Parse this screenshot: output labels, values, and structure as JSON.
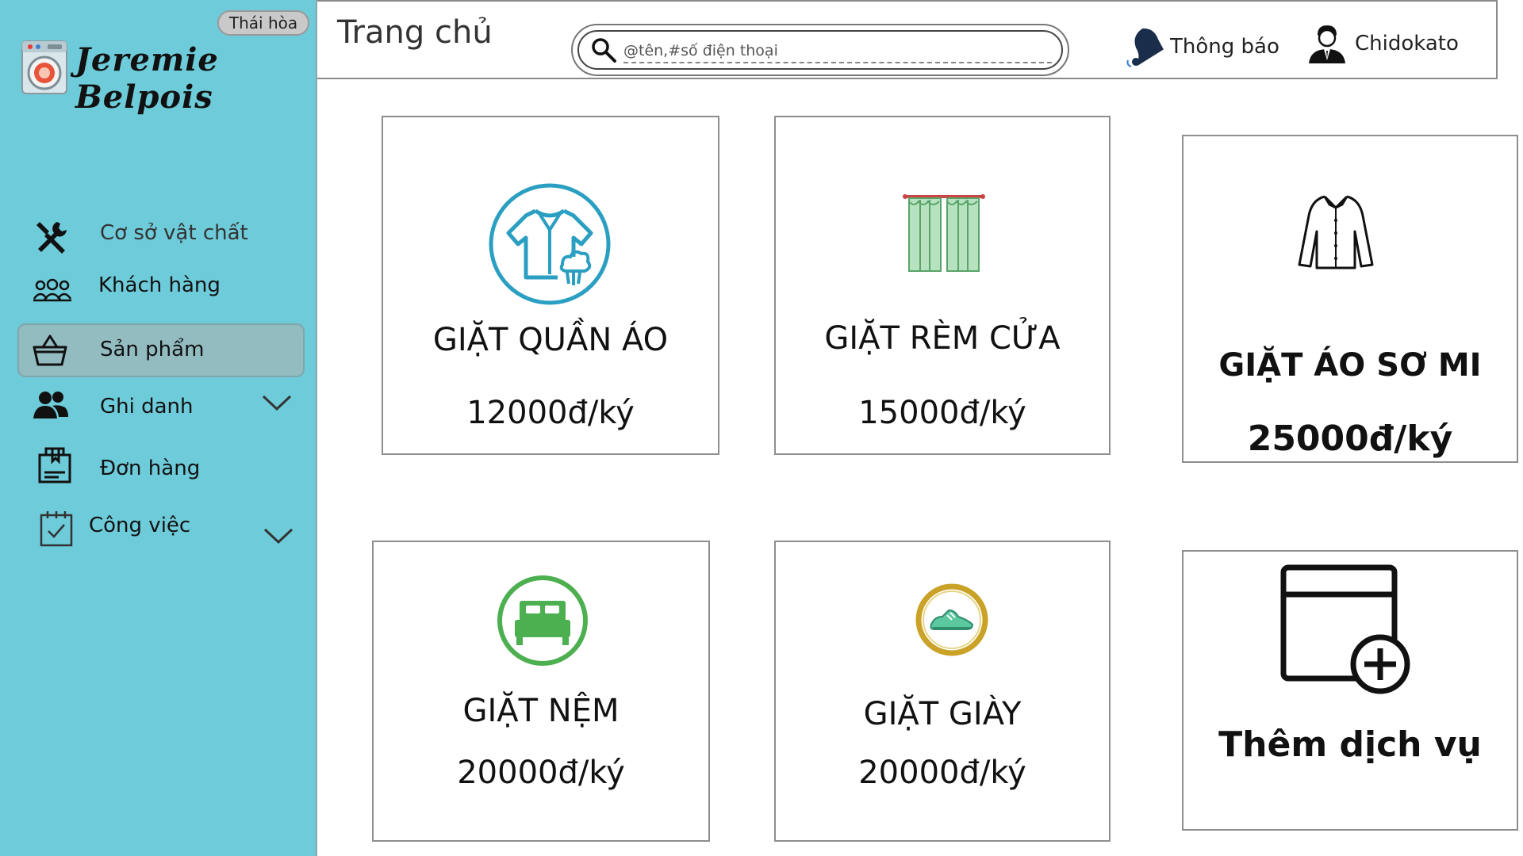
{
  "sidebar": {
    "branch_badge": "Thái hòa",
    "brand_name": "Jeremie Belpois",
    "logo_icon": "washing-machine-icon",
    "items": [
      {
        "label": "Cơ sở vật chất",
        "icon": "tools-icon",
        "active": false,
        "expandable": false
      },
      {
        "label": "Khách hàng",
        "icon": "customers-icon",
        "active": false,
        "expandable": false
      },
      {
        "label": "Sản phẩm",
        "icon": "basket-icon",
        "active": true,
        "expandable": false
      },
      {
        "label": "Ghi danh",
        "icon": "users-icon",
        "active": false,
        "expandable": true
      },
      {
        "label": "Đơn hàng",
        "icon": "package-icon",
        "active": false,
        "expandable": false
      },
      {
        "label": "Công việc",
        "icon": "calendar-check-icon",
        "active": false,
        "expandable": true
      }
    ]
  },
  "header": {
    "title": "Trang chủ",
    "search": {
      "placeholder": "@tên,#số điện thoại",
      "value": ""
    },
    "notifications_label": "Thông báo",
    "user_name": "Chidokato"
  },
  "services": [
    {
      "title": "GIẶT QUẦN ÁO",
      "price": "12000đ/ký",
      "icon": "shirt-wash-icon"
    },
    {
      "title": "GIẶT RÈM CỬA",
      "price": "15000đ/ký",
      "icon": "curtain-icon"
    },
    {
      "title": "GIẶT ÁO SƠ MI",
      "price": "25000đ/ký",
      "icon": "dress-shirt-icon"
    },
    {
      "title": "GIẶT NỆM",
      "price": "20000đ/ký",
      "icon": "bed-icon"
    },
    {
      "title": "GIẶT GIÀY",
      "price": "20000đ/ký",
      "icon": "shoe-icon"
    }
  ],
  "add_service": {
    "label": "Thêm dịch vụ",
    "icon": "add-window-icon"
  },
  "colors": {
    "sidebar_bg": "#6ecbd9",
    "active_item_bg": "#93bcc1",
    "icon_blue": "#2a9fc1",
    "icon_green": "#4caf50"
  }
}
